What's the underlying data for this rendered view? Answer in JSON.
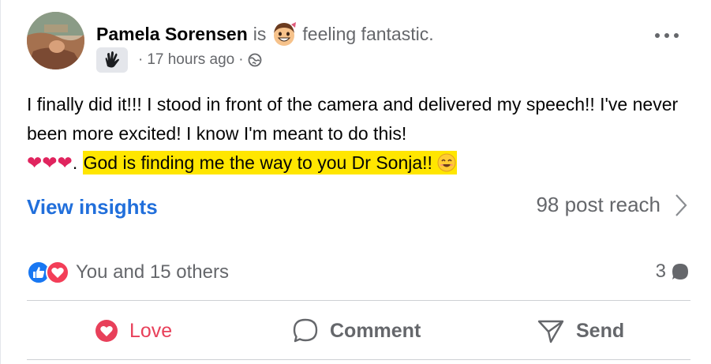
{
  "post": {
    "author": "Pamela Sorensen",
    "is_word": "is",
    "feeling": "feeling fantastic.",
    "timestamp": "17 hours ago",
    "sep": "·",
    "audience_icon": "globe-icon",
    "text_part1": "I finally did it!!!  I stood in front of the camera and delivered my speech!!  I've never been more excited!  I know I'm meant to do this!",
    "hearts": "❤❤❤",
    "after_hearts": ".",
    "highlighted": "God is finding me the way to you Dr Sonja!! "
  },
  "insights": {
    "link_label": "View insights",
    "reach_label": "98 post reach"
  },
  "engagement": {
    "reactions_label": "You and 15 others",
    "comments_count": "3"
  },
  "actions": {
    "love_label": "Love",
    "comment_label": "Comment",
    "send_label": "Send"
  },
  "colors": {
    "link_blue": "#216fdb",
    "love_red": "#e8405a",
    "highlight_yellow": "#ffe600",
    "muted_gray": "#65676b"
  }
}
